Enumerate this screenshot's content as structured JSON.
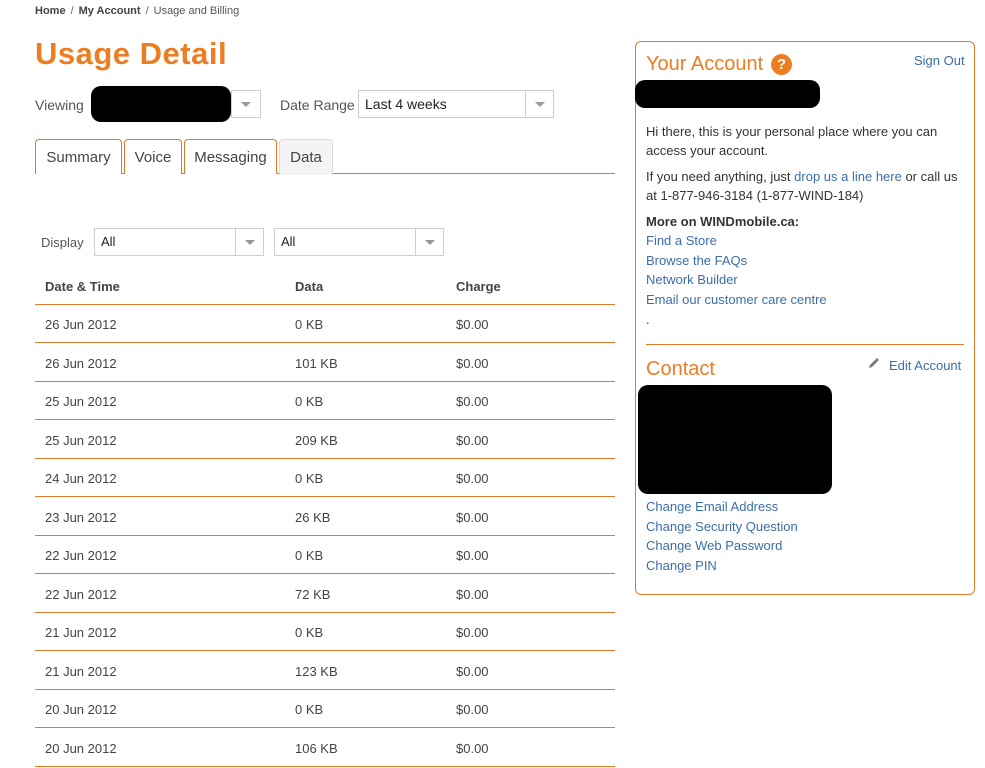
{
  "breadcrumb": {
    "home": "Home",
    "my_account": "My Account",
    "current": "Usage and Billing",
    "sep": "/"
  },
  "page": {
    "title": "Usage Detail",
    "viewing_label": "Viewing",
    "date_range_label": "Date Range",
    "date_range_value": "Last 4 weeks",
    "display_label": "Display",
    "display_filter1": "All",
    "display_filter2": "All"
  },
  "tabs": [
    {
      "label": "Summary"
    },
    {
      "label": "Voice"
    },
    {
      "label": "Messaging"
    },
    {
      "label": "Data",
      "active": true
    }
  ],
  "table": {
    "headers": [
      "Date & Time",
      "Data",
      "Charge"
    ],
    "rows": [
      [
        "26 Jun 2012",
        "0 KB",
        "$0.00"
      ],
      [
        "26 Jun 2012",
        "101 KB",
        "$0.00"
      ],
      [
        "25 Jun 2012",
        "0 KB",
        "$0.00"
      ],
      [
        "25 Jun 2012",
        "209 KB",
        "$0.00"
      ],
      [
        "24 Jun 2012",
        "0 KB",
        "$0.00"
      ],
      [
        "23 Jun 2012",
        "26 KB",
        "$0.00"
      ],
      [
        "22 Jun 2012",
        "0 KB",
        "$0.00"
      ],
      [
        "22 Jun 2012",
        "72 KB",
        "$0.00"
      ],
      [
        "21 Jun 2012",
        "0 KB",
        "$0.00"
      ],
      [
        "21 Jun 2012",
        "123 KB",
        "$0.00"
      ],
      [
        "20 Jun 2012",
        "0 KB",
        "$0.00"
      ],
      [
        "20 Jun 2012",
        "106 KB",
        "$0.00"
      ]
    ]
  },
  "account": {
    "title": "Your Account",
    "help_icon": "?",
    "sign_out": "Sign Out",
    "intro": "Hi there, this is your personal place where you can access your account.",
    "contact_pre": "If you need anything, just ",
    "contact_link": "drop us a line here",
    "contact_post": " or call us at 1-877-946-3184 (1-877-WIND-184)",
    "more_heading": "More on WINDmobile.ca:",
    "links": [
      "Find a Store",
      "Browse the FAQs",
      "Network Builder",
      "Email our customer care centre"
    ],
    "trailing_dot": "."
  },
  "contact": {
    "title": "Contact",
    "edit_account": "Edit Account",
    "links": [
      "Change Email Address",
      "Change Security Question",
      "Change Web Password",
      "Change PIN"
    ]
  },
  "colors": {
    "accent": "#ee7d22",
    "link": "#3b6ea8",
    "redaction": "#000000"
  }
}
